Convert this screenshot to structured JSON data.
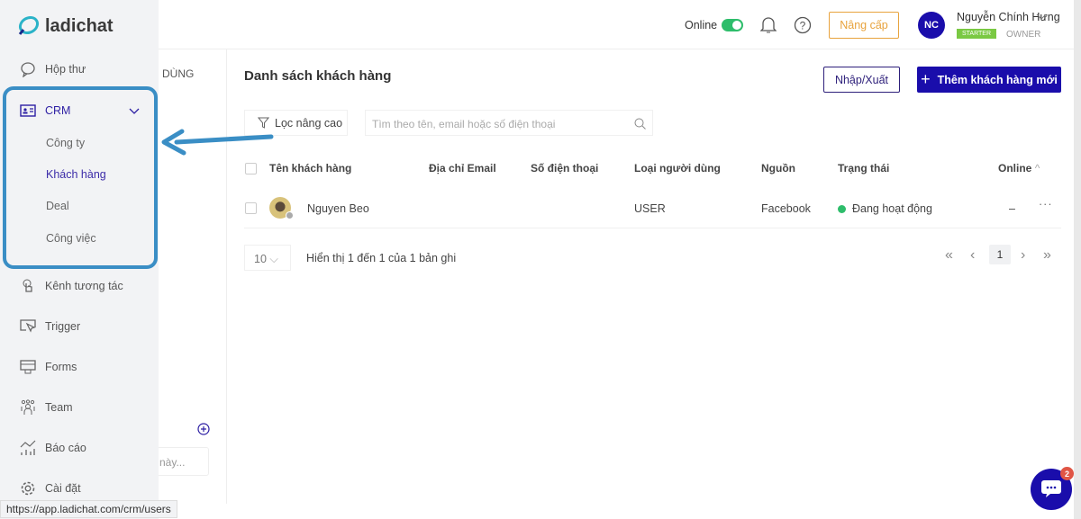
{
  "app": {
    "name": "ladichat"
  },
  "sidebar": {
    "items": [
      {
        "label": "Hộp thư",
        "icon": "chat-bubble-icon"
      },
      {
        "label": "CRM",
        "icon": "contact-card-icon"
      },
      {
        "label": "Kênh tương tác",
        "icon": "touch-icon"
      },
      {
        "label": "Trigger",
        "icon": "cursor-screen-icon"
      },
      {
        "label": "Forms",
        "icon": "form-icon"
      },
      {
        "label": "Team",
        "icon": "team-icon"
      },
      {
        "label": "Báo cáo",
        "icon": "chart-icon"
      },
      {
        "label": "Cài đặt",
        "icon": "gear-icon"
      }
    ],
    "crm_sub": [
      "Công ty",
      "Khách hàng",
      "Deal",
      "Công việc"
    ],
    "active_sub": "Khách hàng"
  },
  "panel2": {
    "heading_fragment": "DÙNG",
    "input_placeholder_fragment": "này..."
  },
  "header": {
    "online_label": "Online",
    "online_on": true,
    "upgrade_label": "Nâng cấp",
    "avatar_initials": "NC",
    "user_name": "Nguyễn Chính Hưng",
    "plan_badge": "STARTER",
    "role": "OWNER"
  },
  "main": {
    "title": "Danh sách khách hàng",
    "import_export": "Nhập/Xuất",
    "add_new": "Thêm khách hàng mới",
    "filter_label": "Lọc nâng cao",
    "search_placeholder": "Tìm theo tên, email hoặc số điện thoại",
    "columns": [
      "Tên khách hàng",
      "Địa chỉ Email",
      "Số điện thoại",
      "Loại người dùng",
      "Nguồn",
      "Trạng thái",
      "Online"
    ],
    "rows": [
      {
        "name": "Nguyen Beo",
        "email": "",
        "phone": "",
        "type": "USER",
        "source": "Facebook",
        "status": "Đang hoạt động",
        "online": "–"
      }
    ],
    "page_size": "10",
    "summary": "Hiển thị 1 đến 1 của 1 bản ghi",
    "current_page": "1"
  },
  "chat_widget": {
    "badge": "2"
  },
  "status_url": "https://app.ladichat.com/crm/users",
  "colors": {
    "primary": "#1a0dab",
    "accent_annotation": "#3a8ec5",
    "status_active": "#2ebd6b",
    "upgrade": "#e8a33d",
    "starter": "#7ac943"
  }
}
